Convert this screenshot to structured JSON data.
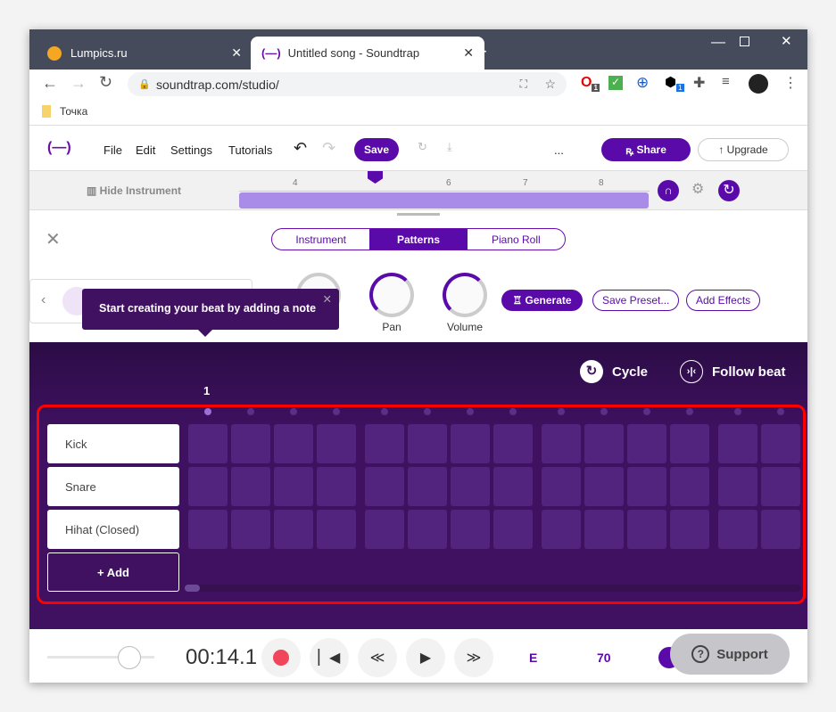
{
  "browser": {
    "tabs": [
      {
        "title": "Lumpics.ru"
      },
      {
        "title": "Untitled song - Soundtrap"
      }
    ],
    "url": "soundtrap.com/studio/",
    "bookmark": "Точка",
    "ext_badges": [
      "1",
      "1"
    ]
  },
  "menu": {
    "file": "File",
    "edit": "Edit",
    "settings": "Settings",
    "tutorials": "Tutorials",
    "save": "Save",
    "more": "...",
    "share": "Share",
    "upgrade": "Upgrade"
  },
  "timeline": {
    "hide_instrument": "Hide Instrument",
    "bars": [
      "4",
      "6",
      "7",
      "8"
    ]
  },
  "editor": {
    "tabs": [
      "Instrument",
      "Patterns",
      "Piano Roll"
    ],
    "active_tab": "Patterns",
    "knobs": {
      "pan": "Pan",
      "volume": "Volume"
    },
    "generate": "Generate",
    "save_preset": "Save Preset...",
    "add_effects": "Add Effects",
    "tooltip": "Start creating your beat by adding a note"
  },
  "patterns": {
    "cycle": "Cycle",
    "follow_beat": "Follow beat",
    "bar_number": "1",
    "tracks": [
      "Kick",
      "Snare",
      "Hihat (Closed)"
    ],
    "add": "+ Add",
    "steps": 14
  },
  "transport": {
    "time": "00:14.1",
    "key": "E",
    "tempo": "70",
    "support": "Support"
  },
  "colors": {
    "brand": "#5a0aa8",
    "record": "#f0455a",
    "highlight": "#ff0000"
  }
}
